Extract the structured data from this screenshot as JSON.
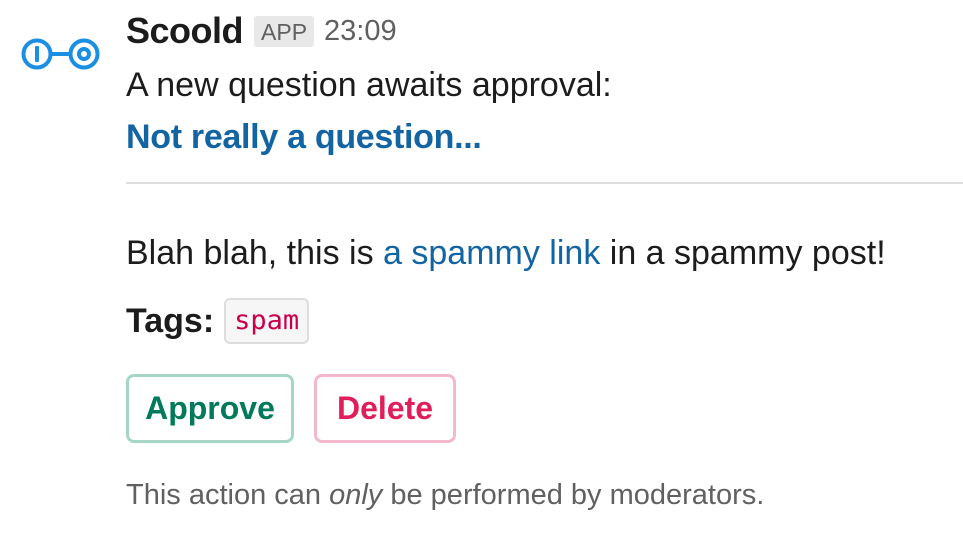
{
  "message": {
    "sender": "Scoold",
    "badge": "APP",
    "time": "23:09",
    "intro": "A new question awaits approval:",
    "question_title": "Not really a question...",
    "body": {
      "before": "Blah blah, this is ",
      "link": "a spammy link",
      "after": " in a spammy post!"
    },
    "tags_label": "Tags:",
    "tags": [
      "spam"
    ],
    "actions": {
      "approve": "Approve",
      "delete": "Delete"
    },
    "footnote": {
      "before": "This action can ",
      "emphasis": "only",
      "after": " be performed by moderators."
    }
  },
  "colors": {
    "link": "#1264a3",
    "approve": "#007a5a",
    "delete": "#e01e5a",
    "tag_text": "#c8004c",
    "avatar": "#1a8fe3"
  },
  "icons": {
    "avatar": "scoold-logo-icon"
  }
}
